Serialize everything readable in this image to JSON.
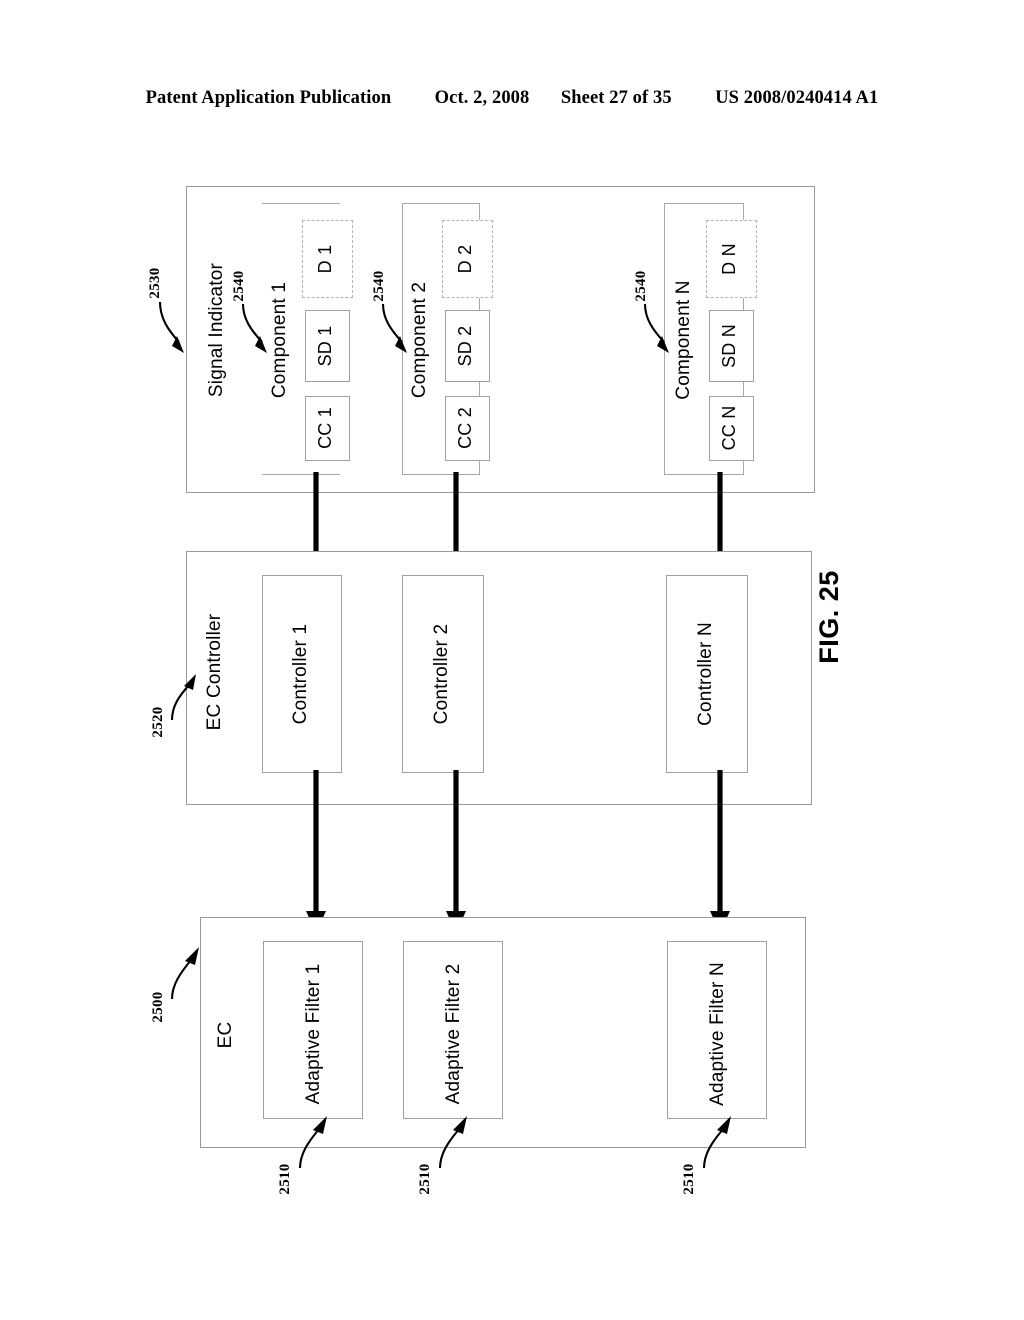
{
  "header": {
    "publication": "Patent Application Publication",
    "date": "Oct. 2, 2008",
    "sheet": "Sheet 27 of 35",
    "patent_number": "US 2008/0240414 A1"
  },
  "figure": {
    "label": "FIG. 25",
    "reference_numerals": {
      "signal_indicator": "2530",
      "component": "2540",
      "ec_controller": "2520",
      "ec": "2500",
      "adaptive_filter": "2510"
    },
    "blocks": {
      "signal_indicator": {
        "title": "Signal Indicator",
        "ref": "2530",
        "components": [
          {
            "title": "Component 1",
            "ref": "2540",
            "sub_blocks": [
              {
                "label": "CC 1",
                "style": "solid"
              },
              {
                "label": "SD 1",
                "style": "solid"
              },
              {
                "label": "D 1",
                "style": "dashed"
              }
            ]
          },
          {
            "title": "Component 2",
            "ref": "2540",
            "sub_blocks": [
              {
                "label": "CC 2",
                "style": "solid"
              },
              {
                "label": "SD 2",
                "style": "solid"
              },
              {
                "label": "D 2",
                "style": "dashed"
              }
            ]
          },
          {
            "title": "Component N",
            "ref": "2540",
            "sub_blocks": [
              {
                "label": "CC N",
                "style": "solid"
              },
              {
                "label": "SD N",
                "style": "solid"
              },
              {
                "label": "D N",
                "style": "dashed"
              }
            ]
          }
        ]
      },
      "ec_controller": {
        "title": "EC Controller",
        "ref": "2520",
        "controllers": [
          {
            "label": "Controller 1"
          },
          {
            "label": "Controller 2"
          },
          {
            "label": "Controller N"
          }
        ]
      },
      "ec": {
        "title": "EC",
        "ref": "2500",
        "filters": [
          {
            "label": "Adaptive Filter 1",
            "ref": "2510"
          },
          {
            "label": "Adaptive Filter 2",
            "ref": "2510"
          },
          {
            "label": "Adaptive Filter N",
            "ref": "2510"
          }
        ]
      }
    }
  },
  "colors": {
    "ink": "#000000",
    "block_stroke": "#9a9a9a",
    "inner_stroke": "#a0a0a0",
    "dashed_stroke": "#b4b4b4"
  }
}
